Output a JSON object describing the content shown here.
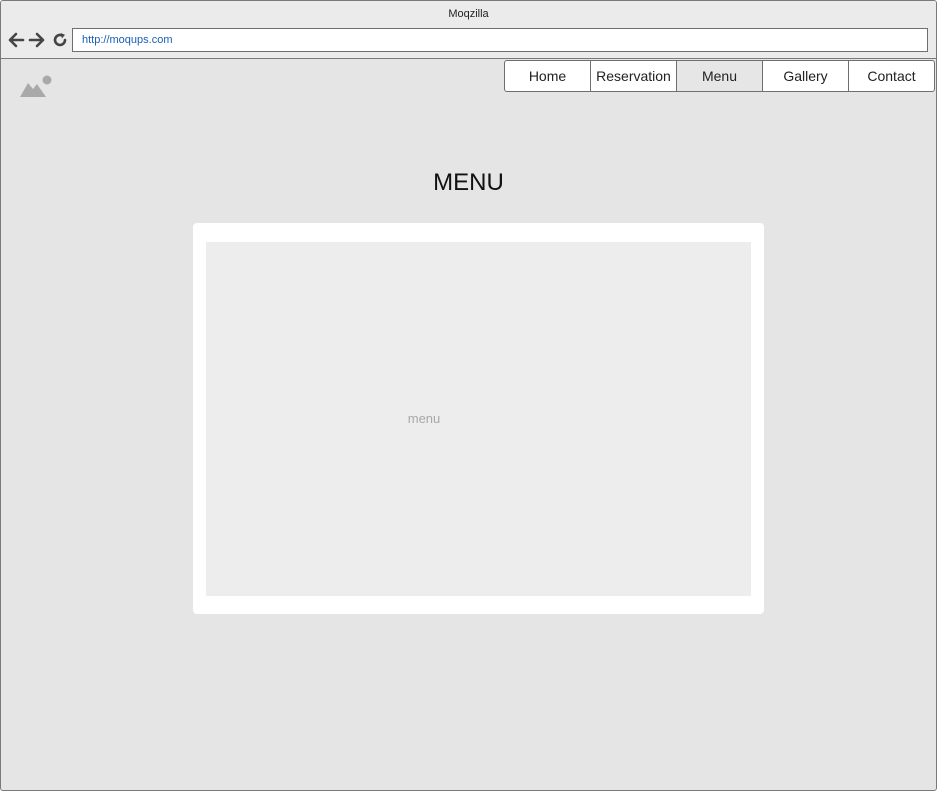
{
  "browser": {
    "title": "Moqzilla",
    "url": "http://moqups.com",
    "icons": [
      "back-arrow-icon",
      "forward-arrow-icon",
      "reload-icon"
    ]
  },
  "logo": {
    "icon": "image-placeholder-icon"
  },
  "nav": {
    "items": [
      {
        "label": "Home"
      },
      {
        "label": "Reservation"
      },
      {
        "label": "Menu"
      },
      {
        "label": "Gallery"
      },
      {
        "label": "Contact"
      }
    ],
    "active": "Menu"
  },
  "page": {
    "heading": "MENU",
    "placeholder": "menu"
  },
  "colors": {
    "background": "#e5e5e5",
    "panel": "#ffffff",
    "panel_inner": "#ededed",
    "link": "#1a5fb4"
  }
}
